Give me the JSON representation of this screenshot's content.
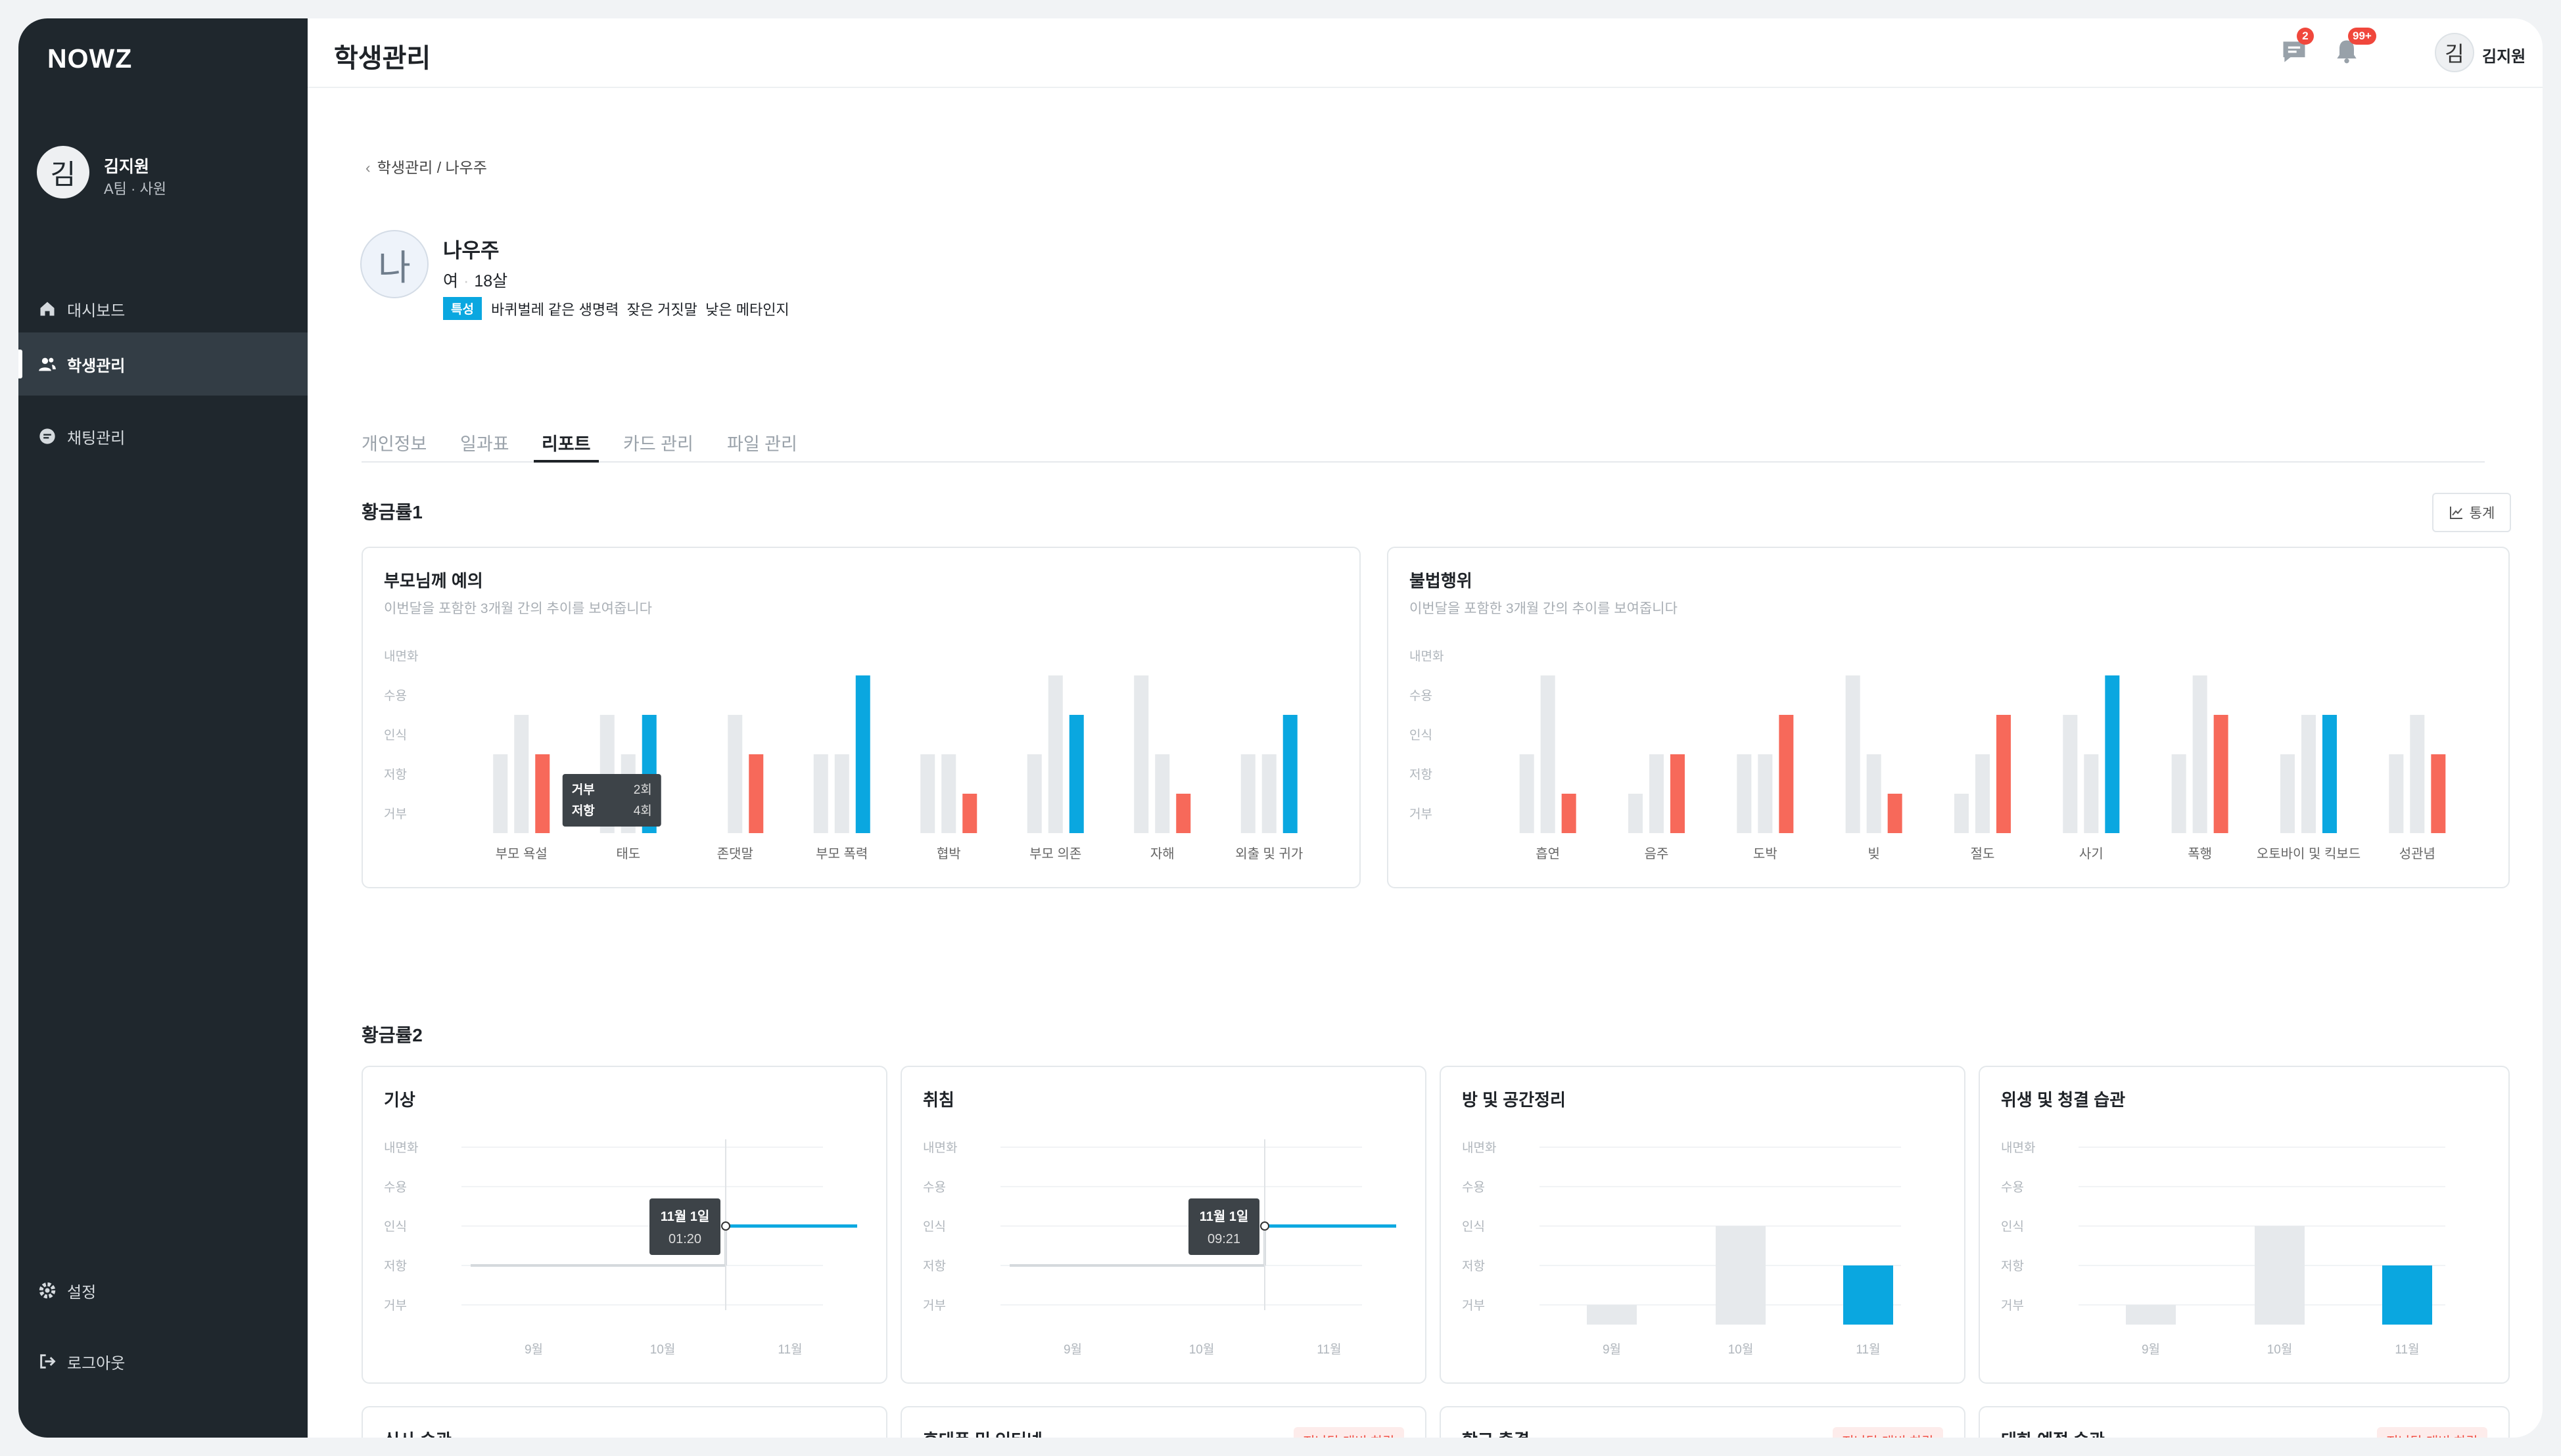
{
  "app": {
    "logo": "NOWZ",
    "page_title": "학생관리"
  },
  "sidebar": {
    "user": {
      "avatar": "김",
      "name": "김지원",
      "role": "A팀 · 사원"
    },
    "items": [
      {
        "label": "대시보드",
        "icon": "home-icon"
      },
      {
        "label": "학생관리",
        "icon": "users-icon",
        "active": true
      },
      {
        "label": "채팅관리",
        "icon": "chat-icon"
      }
    ],
    "bottom": [
      {
        "label": "설정",
        "icon": "gear-icon"
      },
      {
        "label": "로그아웃",
        "icon": "logout-icon"
      }
    ]
  },
  "header": {
    "message_badge": "2",
    "notification_badge": "99+",
    "user_avatar": "김",
    "user_name": "김지원"
  },
  "breadcrumb": "학생관리 / 나우주",
  "student": {
    "avatar": "나",
    "name": "나우주",
    "gender": "여",
    "age": "18살",
    "trait_label": "특성",
    "traits": "바퀴벌레 같은 생명력  잦은 거짓말  낮은 메타인지"
  },
  "tabs": [
    "개인정보",
    "일과표",
    "리포트",
    "카드 관리",
    "파일 관리"
  ],
  "active_tab": "리포트",
  "section1": {
    "title": "황금률1",
    "stats_button": "통계"
  },
  "section2": {
    "title": "황금률2"
  },
  "levels": [
    "내면화",
    "수용",
    "인식",
    "저항",
    "거부"
  ],
  "colors": {
    "gray": "#e6e9ec",
    "blue": "#0aa7e0",
    "red": "#f7695a"
  },
  "bar_cards": [
    {
      "title": "부모님께 예의",
      "subtitle": "이번달을 포함한 3개월 간의 추이를 보여줍니다",
      "categories": [
        "부모 욕설",
        "태도",
        "존댓말",
        "부모 폭력",
        "협박",
        "부모 의존",
        "자해",
        "외출 및 귀가"
      ],
      "series": [
        {
          "values": [
            1.5,
            2.5,
            0,
            1.5,
            1.5,
            1.5,
            3.5,
            1.5
          ]
        },
        {
          "values": [
            2.5,
            1.5,
            2.5,
            1.5,
            1.5,
            3.5,
            1.5,
            1.5
          ]
        },
        {
          "values": [
            1.5,
            2.5,
            1.5,
            3.5,
            0.5,
            2.5,
            0.5,
            2.5
          ],
          "last": true
        }
      ],
      "tooltip": {
        "rows": [
          {
            "label": "거부",
            "value": "2회"
          },
          {
            "label": "저항",
            "value": "4회"
          }
        ]
      }
    },
    {
      "title": "불법행위",
      "subtitle": "이번달을 포함한 3개월 간의 추이를 보여줍니다",
      "categories": [
        "흡연",
        "음주",
        "도박",
        "빚",
        "절도",
        "사기",
        "폭행",
        "오토바이 및 킥보드",
        "성관념"
      ],
      "series": [
        {
          "values": [
            1.5,
            0.5,
            1.5,
            3.5,
            0.5,
            2.5,
            1.5,
            1.5,
            1.5
          ]
        },
        {
          "values": [
            3.5,
            1.5,
            1.5,
            1.5,
            1.5,
            1.5,
            3.5,
            2.5,
            2.5
          ]
        },
        {
          "values": [
            0.5,
            1.5,
            2.5,
            0.5,
            2.5,
            3.5,
            2.5,
            2.5,
            1.5
          ],
          "last": true
        }
      ]
    }
  ],
  "small_cards": [
    {
      "title": "기상",
      "kind": "line",
      "tooltip": {
        "date": "11월 1일",
        "time": "01:20"
      }
    },
    {
      "title": "취침",
      "kind": "line",
      "tooltip": {
        "date": "11월 1일",
        "time": "09:21"
      }
    },
    {
      "title": "방 및 공간정리",
      "kind": "bar",
      "values": [
        0.5,
        2.5,
        1.5
      ]
    },
    {
      "title": "위생 및 청결 습관",
      "kind": "bar",
      "values": [
        0.5,
        2.5,
        1.5
      ]
    }
  ],
  "months": [
    "9월",
    "10월",
    "11월"
  ],
  "bottom_cards": [
    {
      "title": "식사 습관",
      "badge": ""
    },
    {
      "title": "휴대폰 및 인터넷",
      "badge": "지난달 대비 하락"
    },
    {
      "title": "학교 출결",
      "badge": "지난달 대비 하락"
    },
    {
      "title": "대화 예절 습관",
      "badge": "지난달 대비 하락"
    }
  ]
}
